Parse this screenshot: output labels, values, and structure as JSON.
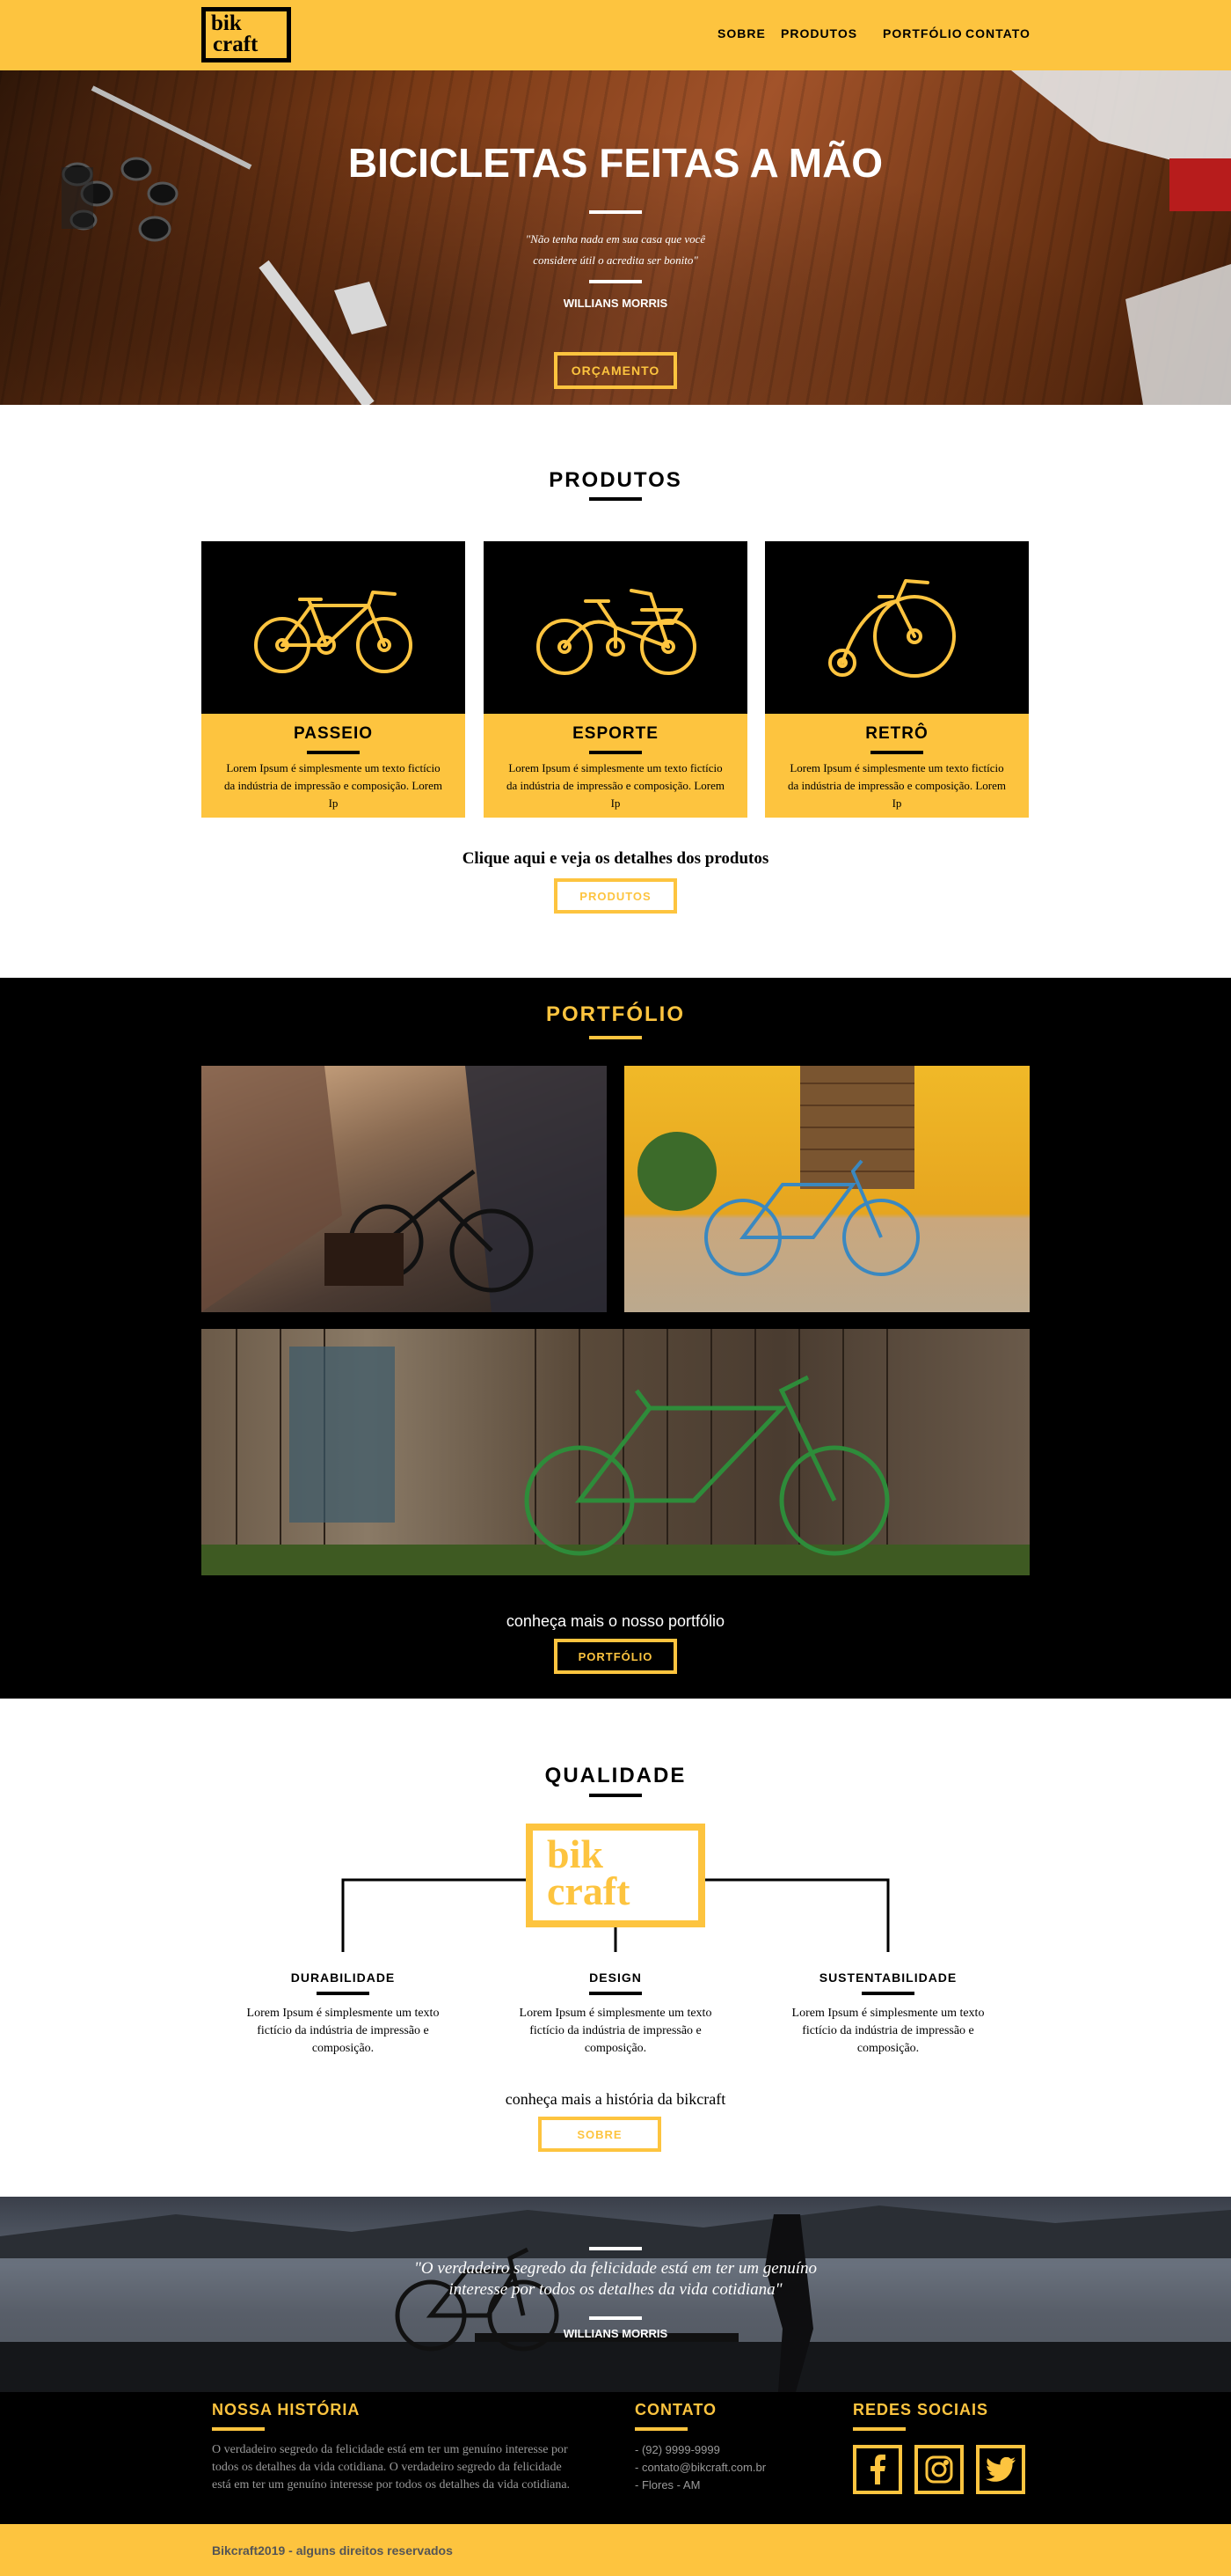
{
  "header": {
    "logo": {
      "line1": "bik",
      "line2": "craft"
    },
    "nav": [
      "SOBRE",
      "PRODUTOS",
      "PORTFÓLIO",
      "CONTATO"
    ]
  },
  "hero": {
    "title": "BICICLETAS FEITAS A MÃO",
    "quote_line1": "\"Não tenha nada em sua casa que você",
    "quote_line2": "considere útil o acredita ser bonito\"",
    "author": "WILLIANS MORRIS",
    "button": "ORÇAMENTO"
  },
  "produtos": {
    "title": "PRODUTOS",
    "items": [
      {
        "name": "PASSEIO",
        "icon": "city-bike-icon",
        "text": "Lorem Ipsum é simplesmente um texto fictício da indústria de impressão e composição. Lorem Ip"
      },
      {
        "name": "ESPORTE",
        "icon": "cruiser-bike-icon",
        "text": "Lorem Ipsum é simplesmente um texto fictício da indústria de impressão e composição. Lorem Ip"
      },
      {
        "name": "RETRÔ",
        "icon": "penny-farthing-icon",
        "text": "Lorem Ipsum é simplesmente um texto fictício da indústria de impressão e composição. Lorem Ip"
      }
    ],
    "cta_text": "Clique aqui e veja os detalhes dos produtos",
    "button": "PRODUTOS"
  },
  "portfolio": {
    "title": "PORTFÓLIO",
    "cta_text": "conheça mais o nosso portfólio",
    "button": "PORTFÓLIO"
  },
  "qualidade": {
    "title": "QUALIDADE",
    "logo": {
      "line1": "bik",
      "line2": "craft"
    },
    "columns": [
      {
        "title": "DURABILIDADE",
        "text": "Lorem Ipsum é simplesmente um texto fictício da indústria de impressão e composição."
      },
      {
        "title": "DESIGN",
        "text": "Lorem Ipsum é simplesmente um texto fictício da indústria de impressão e composição."
      },
      {
        "title": "SUSTENTABILIDADE",
        "text": "Lorem Ipsum é simplesmente um texto fictício da indústria de impressão e composição."
      }
    ],
    "cta_text": "conheça mais a história da bikcraft",
    "button": "SOBRE"
  },
  "banner": {
    "quote_line1": "\"O verdadeiro segredo da felicidade está em ter um genuíno",
    "quote_line2": "interesse por todos os detalhes da vida cotidiana\"",
    "author": "WILLIANS MORRIS"
  },
  "footer": {
    "historia": {
      "title": "NOSSA HISTÓRIA",
      "text": "O verdadeiro segredo da felicidade está em ter um genuíno interesse por todos os detalhes da vida cotidiana. O verdadeiro segredo da felicidade está em ter um genuíno interesse por todos os detalhes da vida cotidiana."
    },
    "contato": {
      "title": "CONTATO",
      "phone": "- (92) 9999-9999",
      "email": "- contato@bikcraft.com.br",
      "location": "- Flores - AM"
    },
    "redes": {
      "title": "REDES SOCIAIS",
      "icons": [
        "facebook-icon",
        "instagram-icon",
        "twitter-icon"
      ]
    },
    "copyright": "Bikcraft2019 - alguns direitos reservados"
  },
  "colors": {
    "accent": "#fdc43f",
    "dark": "#000000",
    "muted": "#999999"
  }
}
